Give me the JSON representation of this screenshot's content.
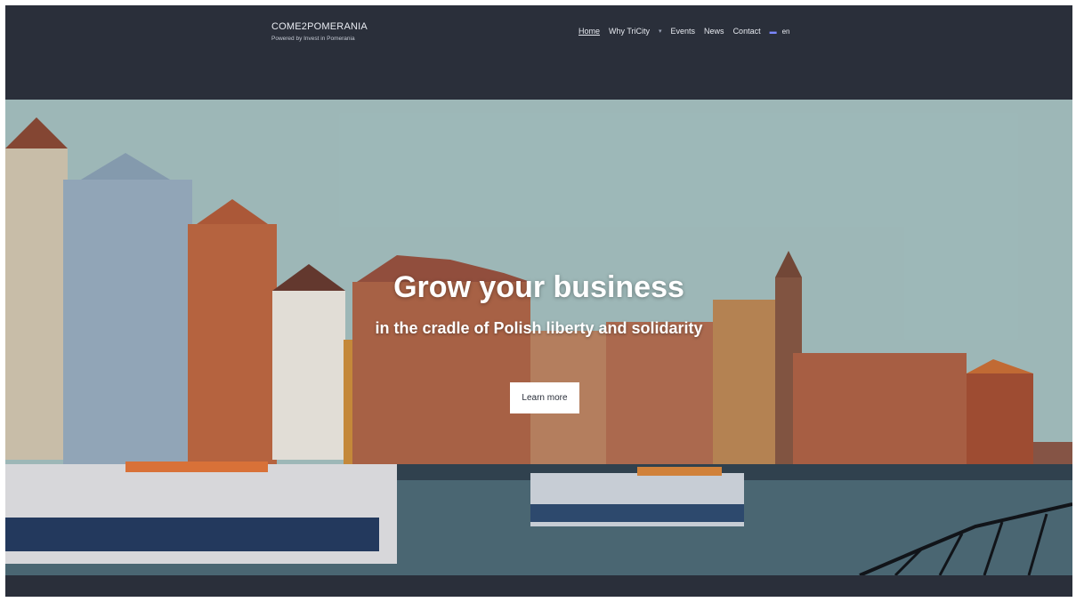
{
  "brand": {
    "title": "COME2POMERANIA",
    "subtitle": "Powered by Invest in Pomerania"
  },
  "nav": {
    "items": [
      {
        "label": "Home",
        "active": true
      },
      {
        "label": "Why TriCity"
      },
      {
        "label": "Events"
      },
      {
        "label": "News"
      },
      {
        "label": "Contact"
      }
    ],
    "language_label": "en"
  },
  "hero": {
    "title": "Grow your business",
    "subtitle": "in the cradle of Polish liberty and solidarity",
    "button_label": "Learn more"
  },
  "colors": {
    "header_bg": "#2a2f3a",
    "button_bg": "#ffffff",
    "hero_text": "#ffffff"
  }
}
